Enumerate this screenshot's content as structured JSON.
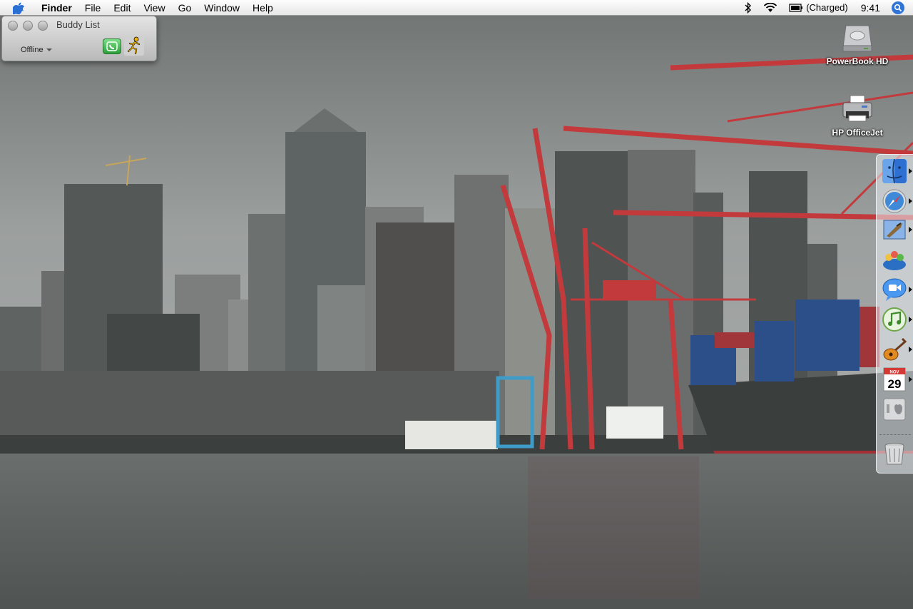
{
  "menubar": {
    "app_menu": "Finder",
    "items": [
      "File",
      "Edit",
      "View",
      "Go",
      "Window",
      "Help"
    ],
    "battery_status": "(Charged)",
    "clock": "9:41"
  },
  "buddy_list": {
    "title": "Buddy List",
    "status": "Offline"
  },
  "desktop_icons": [
    {
      "label": "PowerBook HD",
      "icon": "hard-drive-icon"
    },
    {
      "label": "HP OfficeJet",
      "icon": "printer-icon"
    }
  ],
  "dock": {
    "items": [
      "finder-icon",
      "safari-icon",
      "mail-icon",
      "address-book-icon",
      "ichat-icon",
      "itunes-icon",
      "garageband-icon",
      "ical-icon",
      "system-preferences-icon",
      "trash-icon"
    ],
    "ical_month": "NOV",
    "ical_day": "29"
  },
  "colors": {
    "sky": "#8e9291",
    "water": "#5d6160",
    "crane": "#c33a3d",
    "dock_bg": "#e9eef3",
    "spotlight": "#2f73d6"
  }
}
